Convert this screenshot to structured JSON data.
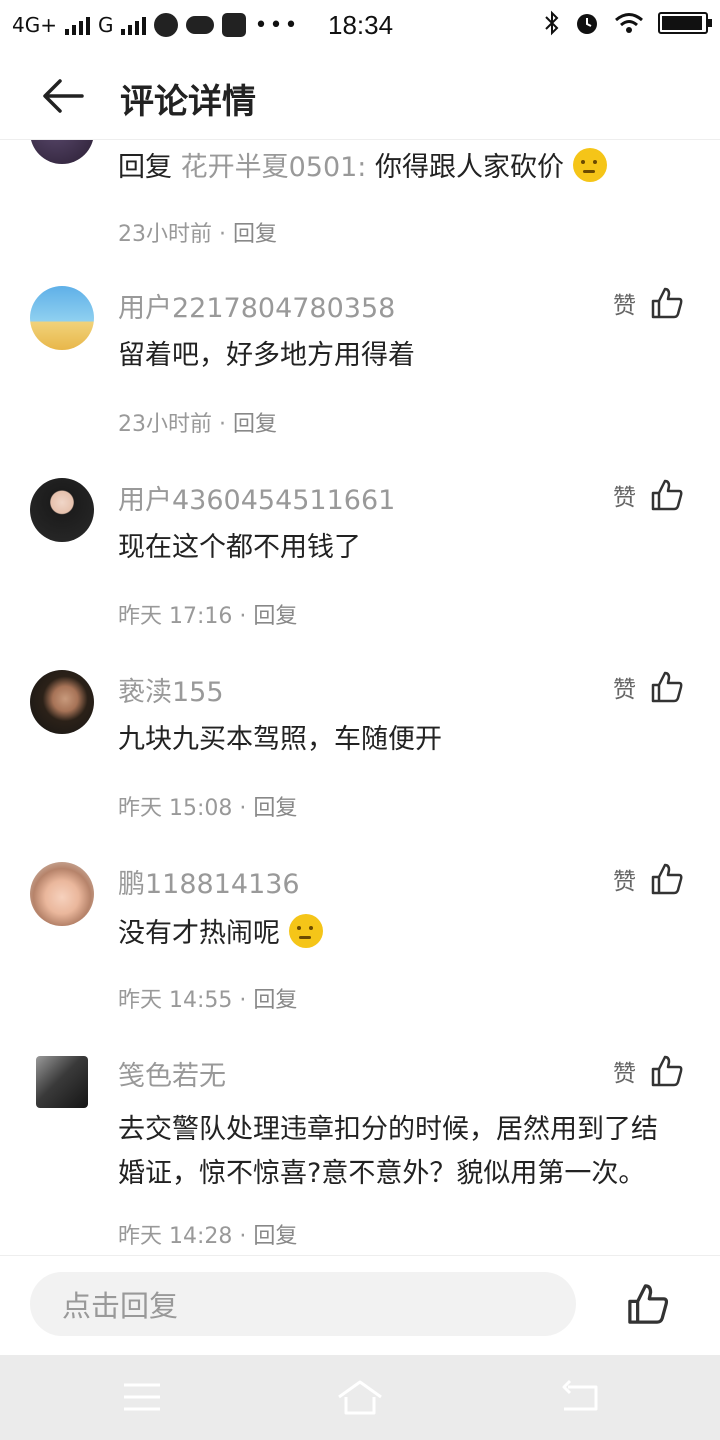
{
  "status_bar": {
    "network1": "4G+",
    "network2": "G",
    "time": "18:34"
  },
  "header": {
    "title": "评论详情"
  },
  "comments": [
    {
      "user": "",
      "reply_prefix": "回复",
      "reply_to": "花开半夏0501:",
      "text": "你得跟人家砍价",
      "emoji": "thinking-emoji",
      "time": "23小时前",
      "reply_label": "回复"
    },
    {
      "user": "用户2217804780358",
      "text": "留着吧，好多地方用得着",
      "time": "23小时前",
      "reply_label": "回复",
      "like_label": "赞"
    },
    {
      "user": "用户4360454511661",
      "text": "现在这个都不用钱了",
      "time": "昨天 17:16",
      "reply_label": "回复",
      "like_label": "赞"
    },
    {
      "user": "亵渎155",
      "text": "九块九买本驾照，车随便开",
      "time": "昨天 15:08",
      "reply_label": "回复",
      "like_label": "赞"
    },
    {
      "user": "鹏118814136",
      "text": "没有才热闹呢",
      "emoji": "thinking-emoji",
      "time": "昨天 14:55",
      "reply_label": "回复",
      "like_label": "赞"
    },
    {
      "user": "笺色若无",
      "text": "去交警队处理违章扣分的时候，居然用到了结婚证，惊不惊喜?意不意外？貌似用第一次。",
      "time": "昨天 14:28",
      "reply_label": "回复",
      "like_label": "赞"
    }
  ],
  "meta_separator": "·",
  "bottom_bar": {
    "input_placeholder": "点击回复"
  },
  "colors": {
    "muted_text": "#999999",
    "input_bg": "#f2f2f2",
    "nav_bg": "#ebebeb"
  }
}
